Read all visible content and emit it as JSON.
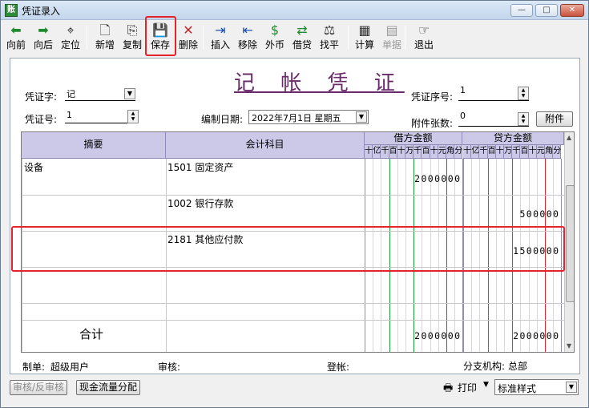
{
  "window": {
    "title": "凭证录入",
    "app_icon_glyph": "账",
    "controls": {
      "minimize": "—",
      "maximize": "□",
      "close": "✕"
    }
  },
  "toolbar": {
    "items": [
      {
        "label": "向前",
        "icon": "arrow-left-icon",
        "glyph": "⬅",
        "color": "#1e8a2e"
      },
      {
        "label": "向后",
        "icon": "arrow-right-icon",
        "glyph": "➡",
        "color": "#1e8a2e"
      },
      {
        "label": "定位",
        "icon": "locate-icon",
        "glyph": "⌖",
        "color": "#333333"
      },
      {
        "label": "新增",
        "icon": "new-document-icon",
        "glyph": "🗋",
        "color": "#333333"
      },
      {
        "label": "复制",
        "icon": "copy-icon",
        "glyph": "⎘",
        "color": "#333333"
      },
      {
        "label": "保存",
        "icon": "save-icon",
        "glyph": "💾",
        "color": "#2a4f9a"
      },
      {
        "label": "删除",
        "icon": "delete-icon",
        "glyph": "✕",
        "color": "#c0272d"
      },
      {
        "label": "插入",
        "icon": "insert-row-icon",
        "glyph": "⇥",
        "color": "#1e4fb0"
      },
      {
        "label": "移除",
        "icon": "remove-row-icon",
        "glyph": "⇤",
        "color": "#1e4fb0"
      },
      {
        "label": "外币",
        "icon": "foreign-currency-icon",
        "glyph": "$",
        "color": "#1e8a2e"
      },
      {
        "label": "借贷",
        "icon": "debit-credit-icon",
        "glyph": "⇄",
        "color": "#1e8a2e"
      },
      {
        "label": "找平",
        "icon": "balance-scale-icon",
        "glyph": "⚖",
        "color": "#333333"
      },
      {
        "label": "计算",
        "icon": "calculator-icon",
        "glyph": "▦",
        "color": "#333333"
      },
      {
        "label": "单据",
        "icon": "document-icon",
        "glyph": "▤",
        "color": "#999999",
        "disabled": true
      },
      {
        "label": "退出",
        "icon": "exit-icon",
        "glyph": "☞",
        "color": "#333333"
      }
    ]
  },
  "voucher": {
    "title": "记 帐 凭 证",
    "type_label": "凭证字:",
    "type_value": "记",
    "number_label": "凭证号:",
    "number_value": "1",
    "date_label": "编制日期:",
    "date_value": "2022年7月1日  星期五",
    "seq_label": "凭证序号:",
    "seq_value": "1",
    "attach_label": "附件张数:",
    "attach_value": "0",
    "attach_button": "附件"
  },
  "table": {
    "headers": {
      "summary": "摘要",
      "account": "会计科目",
      "debit": "借方金额",
      "credit": "贷方金额",
      "digits": [
        "十",
        "亿",
        "千",
        "百",
        "十",
        "万",
        "千",
        "百",
        "十",
        "元",
        "角",
        "分"
      ]
    },
    "rows": [
      {
        "summary": "设备",
        "account": "1501  固定资产",
        "debit": "2000000",
        "credit": ""
      },
      {
        "summary": "",
        "account": "1002  银行存款",
        "debit": "",
        "credit": "500000"
      },
      {
        "summary": "",
        "account": "2181  其他应付款",
        "debit": "",
        "credit": "1500000"
      },
      {
        "summary": "",
        "account": "",
        "debit": "",
        "credit": ""
      },
      {
        "summary": "",
        "account": "",
        "debit": "",
        "credit": ""
      }
    ],
    "total": {
      "label": "合计",
      "debit": "2000000",
      "credit": "2000000"
    }
  },
  "footer": {
    "maker_label": "制单:",
    "maker_value": "超级用户",
    "reviewer_label": "审核:",
    "reviewer_value": "",
    "poster_label": "登帐:",
    "poster_value": "",
    "branch_label": "分支机构:",
    "branch_value": "总部"
  },
  "bottom": {
    "review_button": "审核/反审核",
    "cashflow_button": "现金流量分配",
    "print_button": "打印",
    "print_icon": "printer-icon",
    "style_value": "标准样式"
  },
  "colors": {
    "highlight": "#e5232a",
    "header_bg": "#ccc8e8",
    "title": "#6a2b6a",
    "green_line": "#1e9a3a",
    "red_line": "#e5232a"
  }
}
